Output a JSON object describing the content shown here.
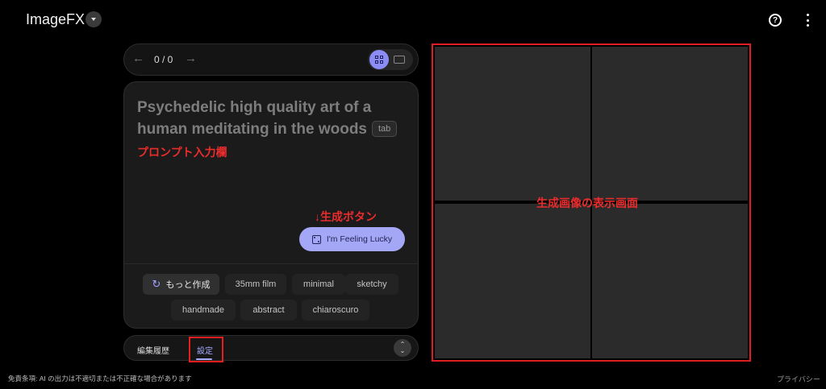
{
  "header": {
    "app_title": "ImageFX",
    "help_icon": "?",
    "more_icon": "more-vert-icon"
  },
  "navigator": {
    "prev_arrow": "←",
    "counter": "0 / 0",
    "next_arrow": "→",
    "view_modes": [
      "grid-view-icon",
      "single-view-icon"
    ],
    "active_view": "grid-view-icon",
    "accent_color": "#8c8cf5"
  },
  "prompt": {
    "text": "Psychedelic high quality art of a human meditating in the woods",
    "tab_hint": "tab",
    "annotation": "プロンプト入力欄"
  },
  "generate": {
    "annotation": "↓生成ボタン",
    "button_label": "I'm Feeling Lucky",
    "button_icon": "dice-icon"
  },
  "chips": {
    "more_label": "もっと作成",
    "items": [
      "35mm film",
      "minimal",
      "sketchy",
      "handmade",
      "abstract",
      "chiaroscuro"
    ]
  },
  "bottom_tabs": {
    "history": "編集履歴",
    "settings": "設定",
    "active": "settings",
    "expand_up": "⌃",
    "expand_down": "⌄"
  },
  "image_area": {
    "annotation": "生成画像の表示画面",
    "tile_count": 4,
    "highlight_color": "#e11c24"
  },
  "footer": {
    "terms": "免責条項: AI の出力は不適切または不正確な場合があります",
    "privacy": "プライバシー"
  }
}
